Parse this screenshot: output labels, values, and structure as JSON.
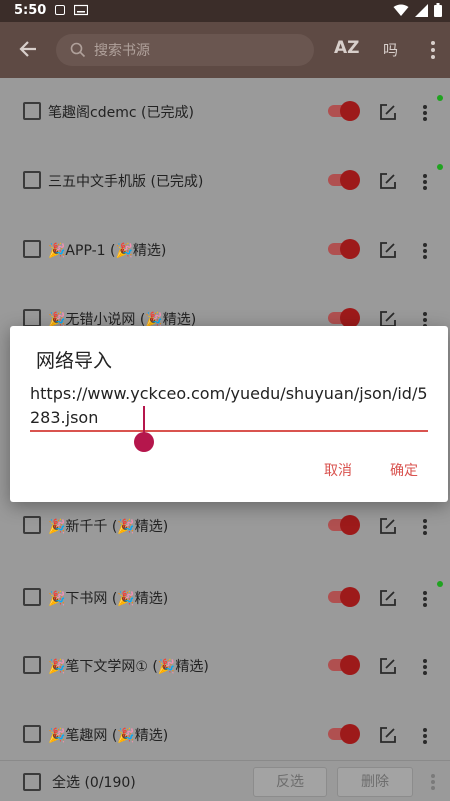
{
  "status_bar": {
    "time": "5:50"
  },
  "toolbar": {
    "search_placeholder": "搜索书源",
    "sort_label": "AZ",
    "group_label": "吗"
  },
  "sources": [
    {
      "name": "笔趣阁cdemc (已完成)",
      "enabled": true,
      "dot": true
    },
    {
      "name": "三五中文手机版 (已完成)",
      "enabled": true,
      "dot": true
    },
    {
      "name": "🎉APP-1 (🎉精选)",
      "enabled": true,
      "dot": false
    },
    {
      "name": "🎉无错小说网 (🎉精选)",
      "enabled": true,
      "dot": false
    },
    {
      "name": "",
      "enabled": true,
      "dot": false
    },
    {
      "name": "🎉新千千 (🎉精选)",
      "enabled": true,
      "dot": false
    },
    {
      "name": "🎉下书网 (🎉精选)",
      "enabled": true,
      "dot": true
    },
    {
      "name": "🎉笔下文学网① (🎉精选)",
      "enabled": true,
      "dot": false
    },
    {
      "name": "🎉笔趣网 (🎉精选)",
      "enabled": true,
      "dot": false
    }
  ],
  "bottom_bar": {
    "select_all": "全选 (0/190)",
    "invert": "反选",
    "delete": "删除"
  },
  "dialog": {
    "title": "网络导入",
    "url_value": "https://www.yckceo.com/yuedu/shuyuan/json/id/5283.json",
    "cancel": "取消",
    "ok": "确定"
  },
  "colors": {
    "accent": "#d9534f",
    "appbar": "#5e4a44",
    "status_bar": "#3b2d29",
    "cursor": "#b5164c"
  }
}
